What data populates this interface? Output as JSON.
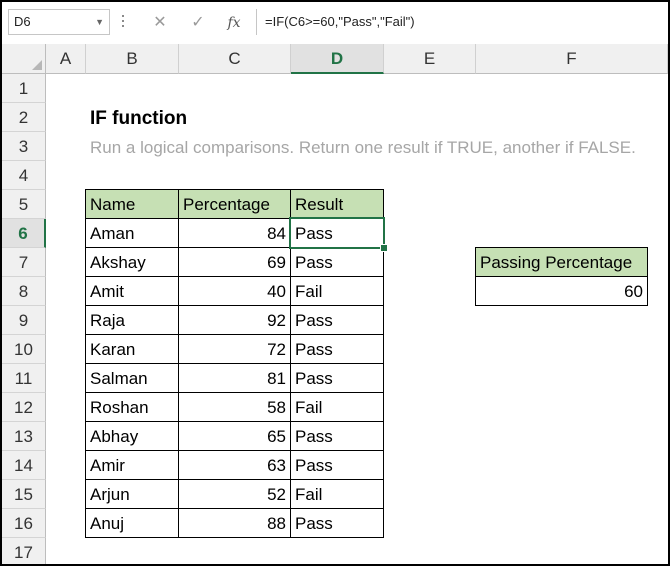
{
  "formula_bar": {
    "name_box": "D6",
    "cancel_symbol": "✕",
    "enter_symbol": "✓",
    "fx_label": "fx",
    "formula": "=IF(C6>=60,\"Pass\",\"Fail\")"
  },
  "columns": [
    "A",
    "B",
    "C",
    "D",
    "E",
    "F"
  ],
  "selected_column": "D",
  "rows": [
    "1",
    "2",
    "3",
    "4",
    "5",
    "6",
    "7",
    "8",
    "9",
    "10",
    "11",
    "12",
    "13",
    "14",
    "15",
    "16",
    "17"
  ],
  "selected_row": "6",
  "sheet": {
    "title": "IF function",
    "subtitle": "Run a logical comparisons. Return one result if TRUE, another if FALSE.",
    "table": {
      "headers": [
        "Name",
        "Percentage",
        "Result"
      ],
      "rows": [
        [
          "Aman",
          "84",
          "Pass"
        ],
        [
          "Akshay",
          "69",
          "Pass"
        ],
        [
          "Amit",
          "40",
          "Fail"
        ],
        [
          "Raja",
          "92",
          "Pass"
        ],
        [
          "Karan",
          "72",
          "Pass"
        ],
        [
          "Salman",
          "81",
          "Pass"
        ],
        [
          "Roshan",
          "58",
          "Fail"
        ],
        [
          "Abhay",
          "65",
          "Pass"
        ],
        [
          "Amir",
          "63",
          "Pass"
        ],
        [
          "Arjun",
          "52",
          "Fail"
        ],
        [
          "Anuj",
          "88",
          "Pass"
        ]
      ]
    },
    "passing": {
      "label": "Passing Percentage",
      "value": "60"
    }
  },
  "colors": {
    "header_fill": "#c6e0b4",
    "accent": "#217346",
    "subtitle_text": "#a6a6a6"
  }
}
